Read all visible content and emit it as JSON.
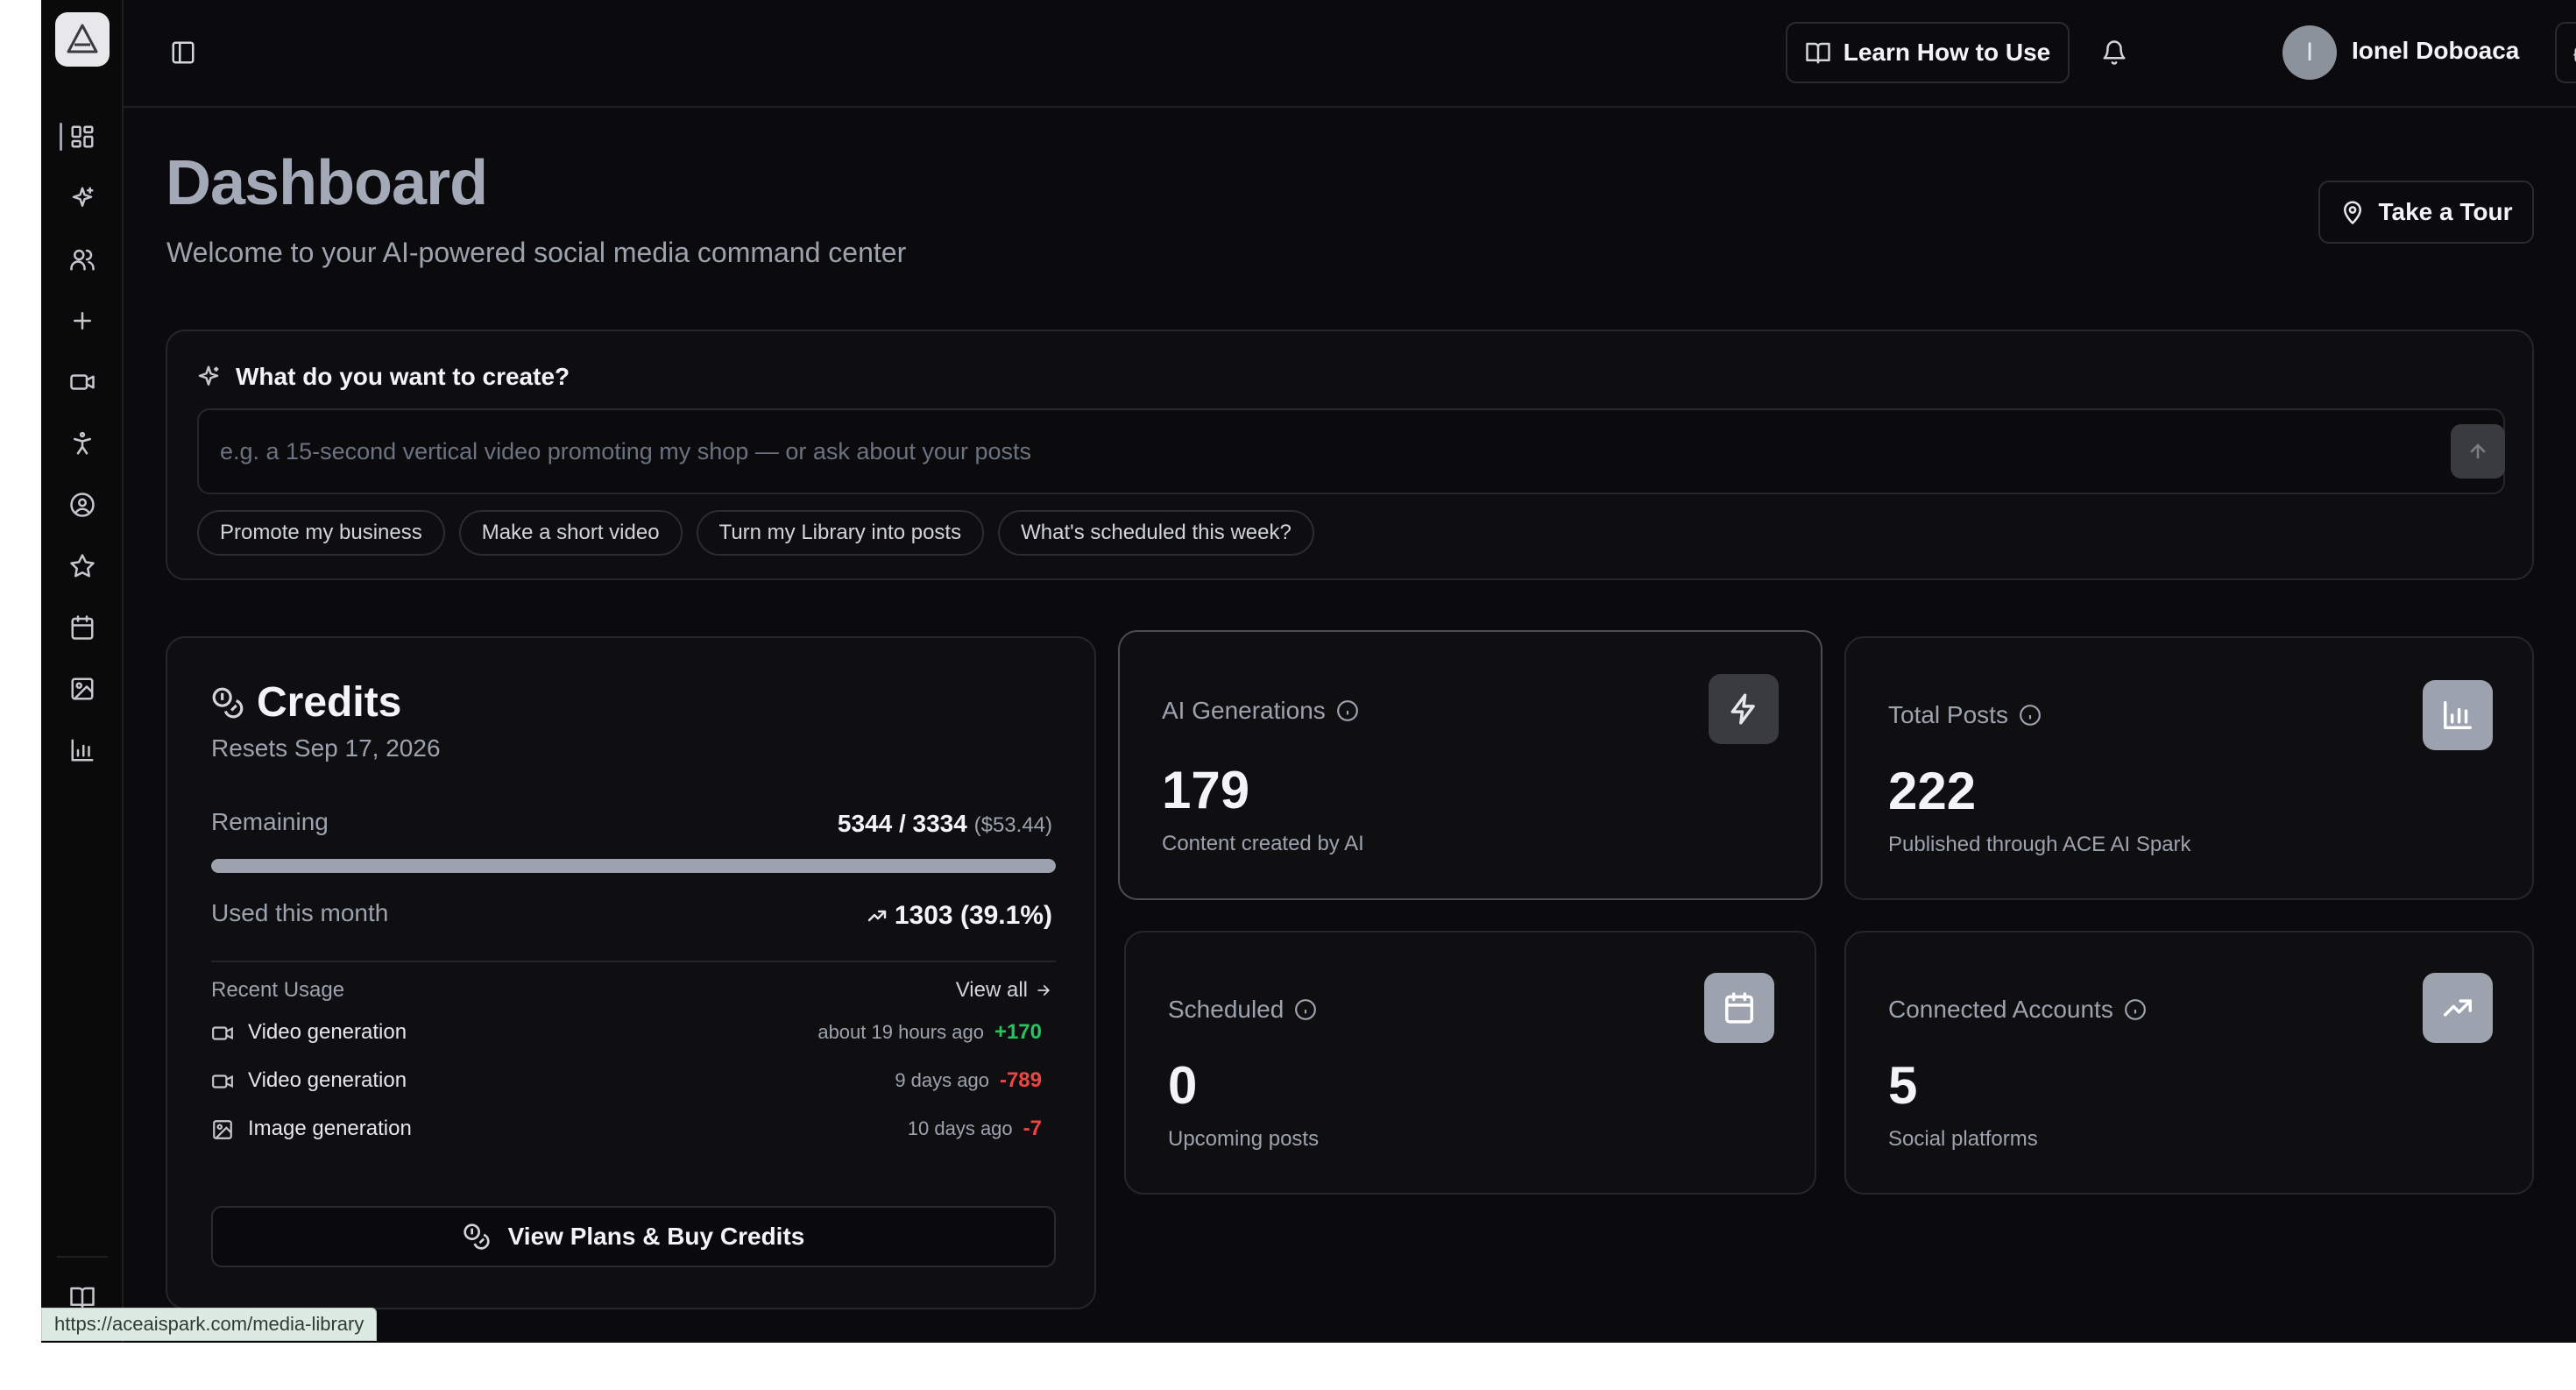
{
  "header": {
    "learn_label": "Learn How to Use",
    "user_initial": "I",
    "user_name": "Ionel Doboaca"
  },
  "page": {
    "title": "Dashboard",
    "subtitle": "Welcome to your AI-powered social media command center",
    "tour_label": "Take a Tour"
  },
  "create": {
    "heading": "What do you want to create?",
    "placeholder": "e.g. a 15-second vertical video promoting my shop — or ask about your posts",
    "value": "",
    "suggestions": [
      "Promote my business",
      "Make a short video",
      "Turn my Library into posts",
      "What's scheduled this week?"
    ]
  },
  "credits": {
    "title": "Credits",
    "resets": "Resets Sep 17, 2026",
    "remaining_label": "Remaining",
    "remaining_value": "5344 / 3334",
    "remaining_dollars": "($53.44)",
    "remaining_fraction": 1.0,
    "used_label": "Used this month",
    "used_value": "1303 (39.1%)",
    "recent_label": "Recent Usage",
    "view_all": "View all",
    "recent": [
      {
        "icon": "video-icon",
        "name": "Video generation",
        "time": "about 19 hours ago",
        "amount": "+170",
        "sign": "pos"
      },
      {
        "icon": "video-icon",
        "name": "Video generation",
        "time": "9 days ago",
        "amount": "-789",
        "sign": "neg"
      },
      {
        "icon": "image-icon",
        "name": "Image generation",
        "time": "10 days ago",
        "amount": "-7",
        "sign": "neg"
      }
    ],
    "buy_label": "View Plans & Buy Credits"
  },
  "stats": {
    "ai_generations": {
      "label": "AI Generations",
      "value": "179",
      "sub": "Content created by AI",
      "icon": "lightning-icon"
    },
    "total_posts": {
      "label": "Total Posts",
      "value": "222",
      "sub": "Published through ACE AI Spark",
      "icon": "bar-chart-icon"
    },
    "scheduled": {
      "label": "Scheduled",
      "value": "0",
      "sub": "Upcoming posts",
      "icon": "calendar-icon"
    },
    "connected": {
      "label": "Connected Accounts",
      "value": "5",
      "sub": "Social platforms",
      "icon": "trending-up-icon"
    }
  },
  "status_bar": {
    "url": "https://aceaispark.com/media-library"
  },
  "sidebar": {
    "items": [
      {
        "icon": "dashboard-icon"
      },
      {
        "icon": "sparkles-icon"
      },
      {
        "icon": "users-icon"
      },
      {
        "icon": "plus-icon"
      },
      {
        "icon": "video-icon"
      },
      {
        "icon": "accessibility-icon"
      },
      {
        "icon": "user-circle-icon"
      },
      {
        "icon": "star-icon"
      },
      {
        "icon": "calendar-icon"
      },
      {
        "icon": "image-icon"
      },
      {
        "icon": "bar-chart-icon"
      },
      {
        "icon": "book-open-icon"
      }
    ]
  },
  "colors": {
    "background": "#0b0b0d",
    "card": "#0f0f12",
    "positive": "#22c55e",
    "negative": "#ef4444",
    "title": "#a3a9b6"
  }
}
